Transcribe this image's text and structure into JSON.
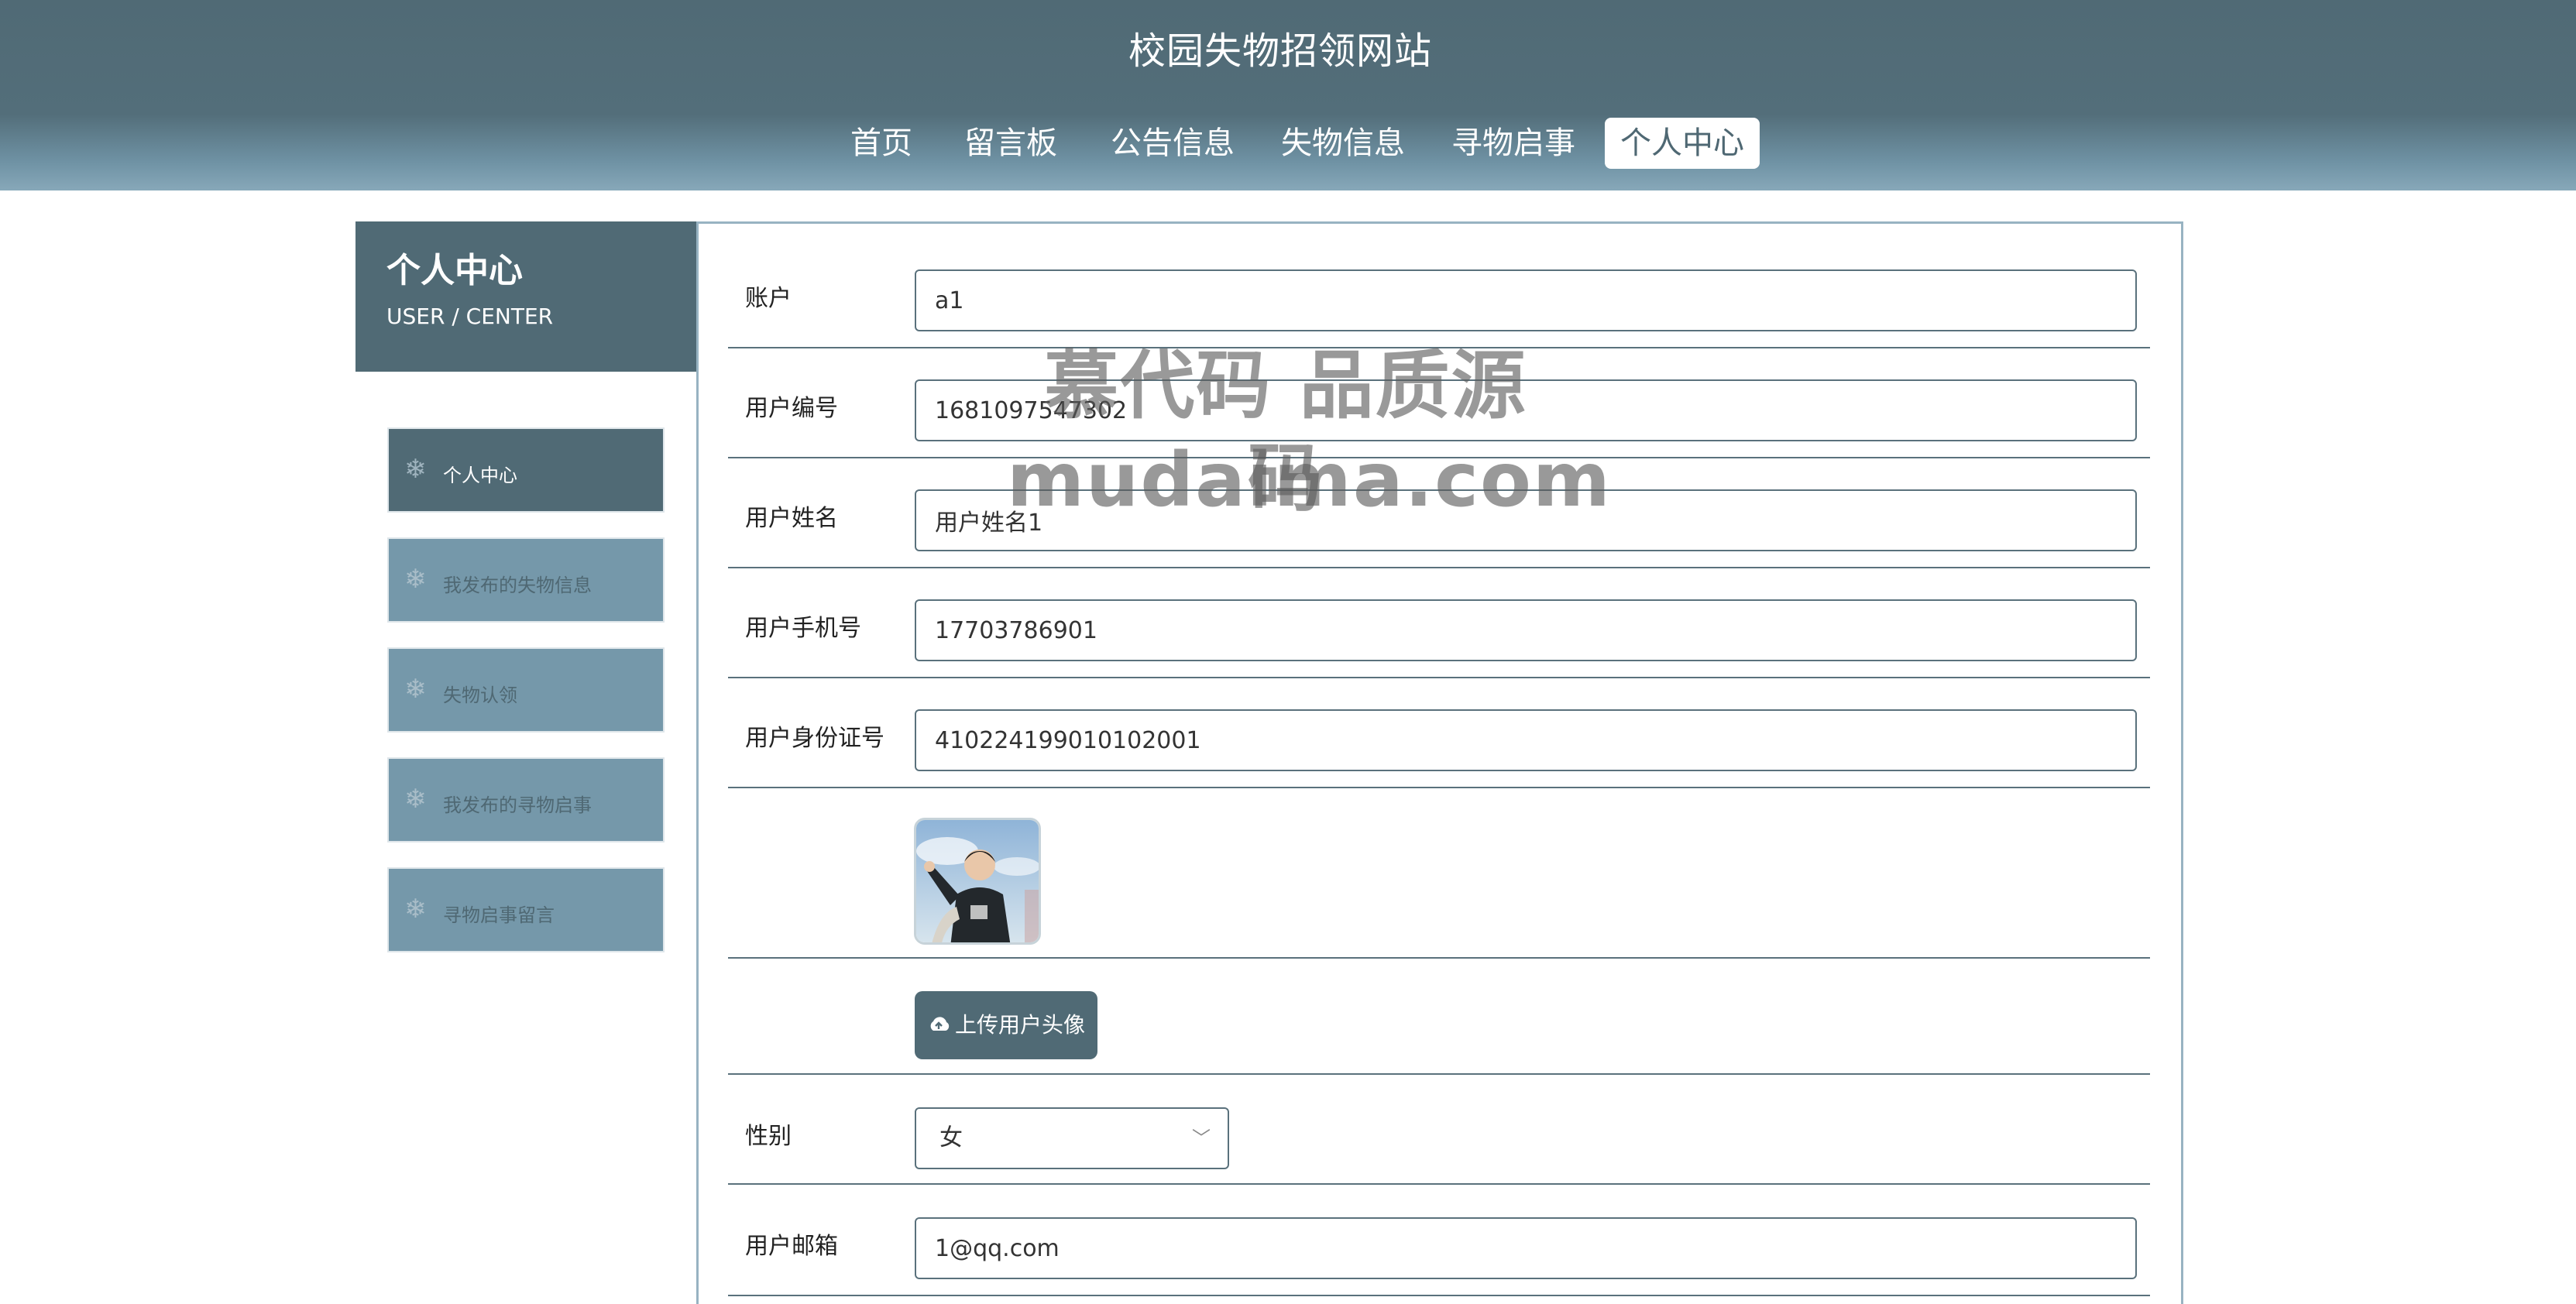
{
  "site": {
    "title": "校园失物招领网站"
  },
  "nav": {
    "items": [
      {
        "label": "首页",
        "active": false
      },
      {
        "label": "留言板",
        "active": false
      },
      {
        "label": "公告信息",
        "active": false
      },
      {
        "label": "失物信息",
        "active": false
      },
      {
        "label": "寻物启事",
        "active": false
      },
      {
        "label": "个人中心",
        "active": true
      }
    ]
  },
  "sidebar": {
    "title": "个人中心",
    "subtitle": "USER / CENTER",
    "items": [
      {
        "label": "个人中心",
        "active": true
      },
      {
        "label": "我发布的失物信息",
        "active": false
      },
      {
        "label": "失物认领",
        "active": false
      },
      {
        "label": "我发布的寻物启事",
        "active": false
      },
      {
        "label": "寻物启事留言",
        "active": false
      }
    ]
  },
  "form": {
    "account": {
      "label": "账户",
      "value": "a1"
    },
    "user_no": {
      "label": "用户编号",
      "value": "1681097547302"
    },
    "user_name": {
      "label": "用户姓名",
      "value": "用户姓名1"
    },
    "phone": {
      "label": "用户手机号",
      "value": "17703786901"
    },
    "id_card": {
      "label": "用户身份证号",
      "value": "410224199010102001"
    },
    "upload_label": "上传用户头像",
    "gender": {
      "label": "性别",
      "value": "女"
    },
    "email": {
      "label": "用户邮箱",
      "value": "1@qq.com"
    }
  },
  "watermark": {
    "line1": "慕代码 品质源码",
    "line2": "mudaima.com"
  },
  "colors": {
    "primary": "#506a75",
    "secondary": "#7598aa",
    "border": "#5a717c"
  }
}
